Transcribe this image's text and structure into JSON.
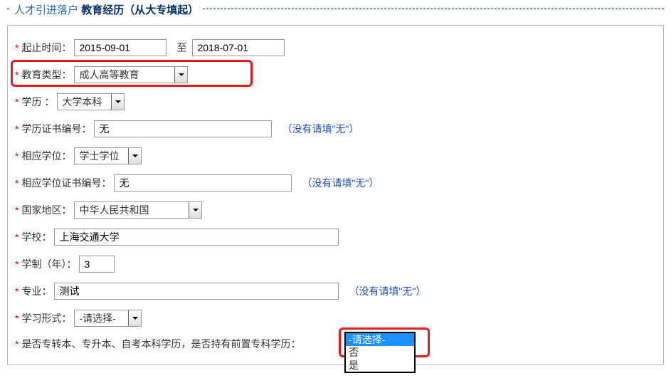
{
  "header": {
    "category": "人才引进落户",
    "section": "教育经历（从大专填起）"
  },
  "dates": {
    "label": "起止时间：",
    "start": "2015-09-01",
    "to": "至",
    "end": "2018-07-01"
  },
  "edu_type": {
    "label": "教育类型：",
    "value": "成人高等教育"
  },
  "degree_level": {
    "label": "学历 ：",
    "value": "大学本科"
  },
  "cert_no": {
    "label": "学历证书编号：",
    "value": "无",
    "hint": "（没有请填\"无\"）"
  },
  "degree": {
    "label": "相应学位：",
    "value": "学士学位"
  },
  "degree_cert_no": {
    "label": "相应学位证书编号：",
    "value": "无",
    "hint": "（没有请填\"无\"）"
  },
  "country": {
    "label": "国家地区：",
    "value": "中华人民共和国"
  },
  "school": {
    "label": "学校：",
    "value": "上海交通大学"
  },
  "years": {
    "label": "学制（年）：",
    "value": "3"
  },
  "major": {
    "label": "专业：",
    "value": "测试",
    "hint": "（没有请填\"无\"）"
  },
  "study_form": {
    "label": "学习形式：",
    "value": "-请选择-"
  },
  "prior_diploma": {
    "label": "是否专转本、专升本、自考本科学历，是否持有前置专科学历：",
    "options": [
      "-请选择-",
      "否",
      "是"
    ],
    "selected": "-请选择-"
  }
}
